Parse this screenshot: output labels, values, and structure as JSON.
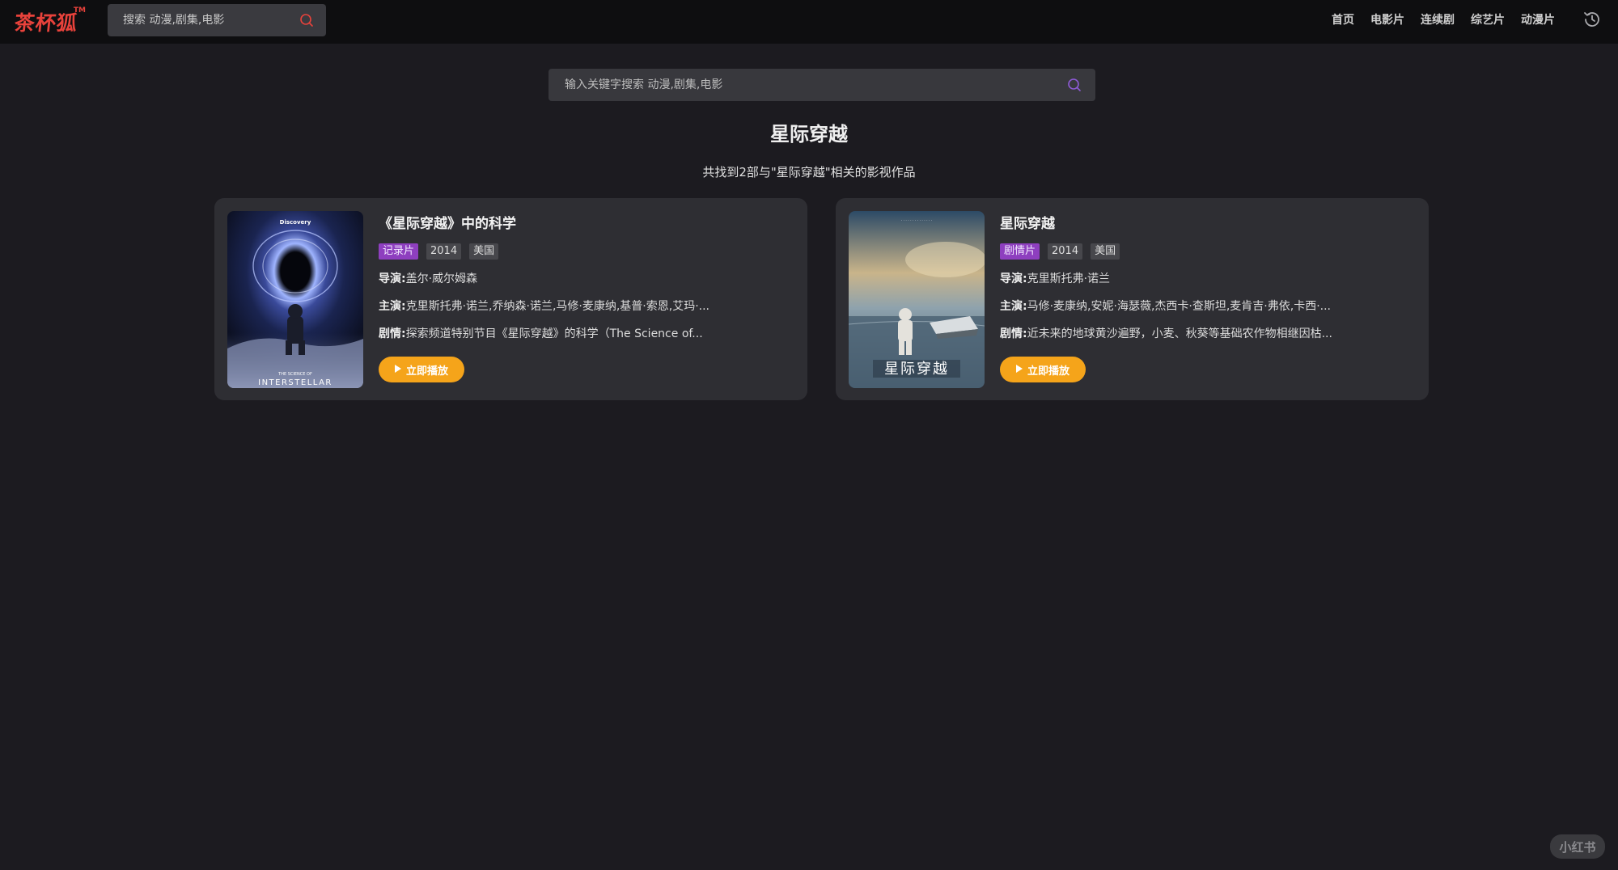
{
  "header": {
    "logo_text": "茶杯狐",
    "logo_tm": "TM",
    "search_placeholder": "搜索 动漫,剧集,电影",
    "nav": [
      "首页",
      "电影片",
      "连续剧",
      "综艺片",
      "动漫片"
    ]
  },
  "main": {
    "search_placeholder": "输入关键字搜索 动漫,剧集,电影",
    "title": "星际穿越",
    "result_count": "共找到2部与\"星际穿越\"相关的影视作品"
  },
  "results": [
    {
      "title": "《星际穿越》中的科学",
      "genre": "记录片",
      "year": "2014",
      "region": "美国",
      "director_label": "导演:",
      "director": "盖尔·威尔姆森",
      "cast_label": "主演:",
      "cast": "克里斯托弗·诺兰,乔纳森·诺兰,马修·麦康纳,基普·索恩,艾玛·...",
      "plot_label": "剧情:",
      "plot": "探索频道特别节目《星际穿越》的科学（The Science of...",
      "play_label": "立即播放",
      "poster_top": "Discovery",
      "poster_sub": "THE SCIENCE OF",
      "poster_name": "INTERSTELLAR"
    },
    {
      "title": "星际穿越",
      "genre": "剧情片",
      "year": "2014",
      "region": "美国",
      "director_label": "导演:",
      "director": "克里斯托弗·诺兰",
      "cast_label": "主演:",
      "cast": "马修·麦康纳,安妮·海瑟薇,杰西卡·查斯坦,麦肯吉·弗依,卡西·...",
      "plot_label": "剧情:",
      "plot": "近未来的地球黄沙遍野，小麦、秋葵等基础农作物相继因枯...",
      "play_label": "立即播放",
      "poster_name": "星际穿越"
    }
  ],
  "watermark": "小红书",
  "colors": {
    "background": "#1c1b20",
    "header": "#0e0e10",
    "card": "#2e2e33",
    "accent_logo": "#e8423b",
    "genre_tag": "#8e3fbf",
    "play_button": "#f5a41a",
    "search_icon_top": "#e8423b",
    "search_icon_main": "#8e5bd6"
  },
  "icons": [
    "search-icon",
    "history-icon",
    "play-icon"
  ]
}
